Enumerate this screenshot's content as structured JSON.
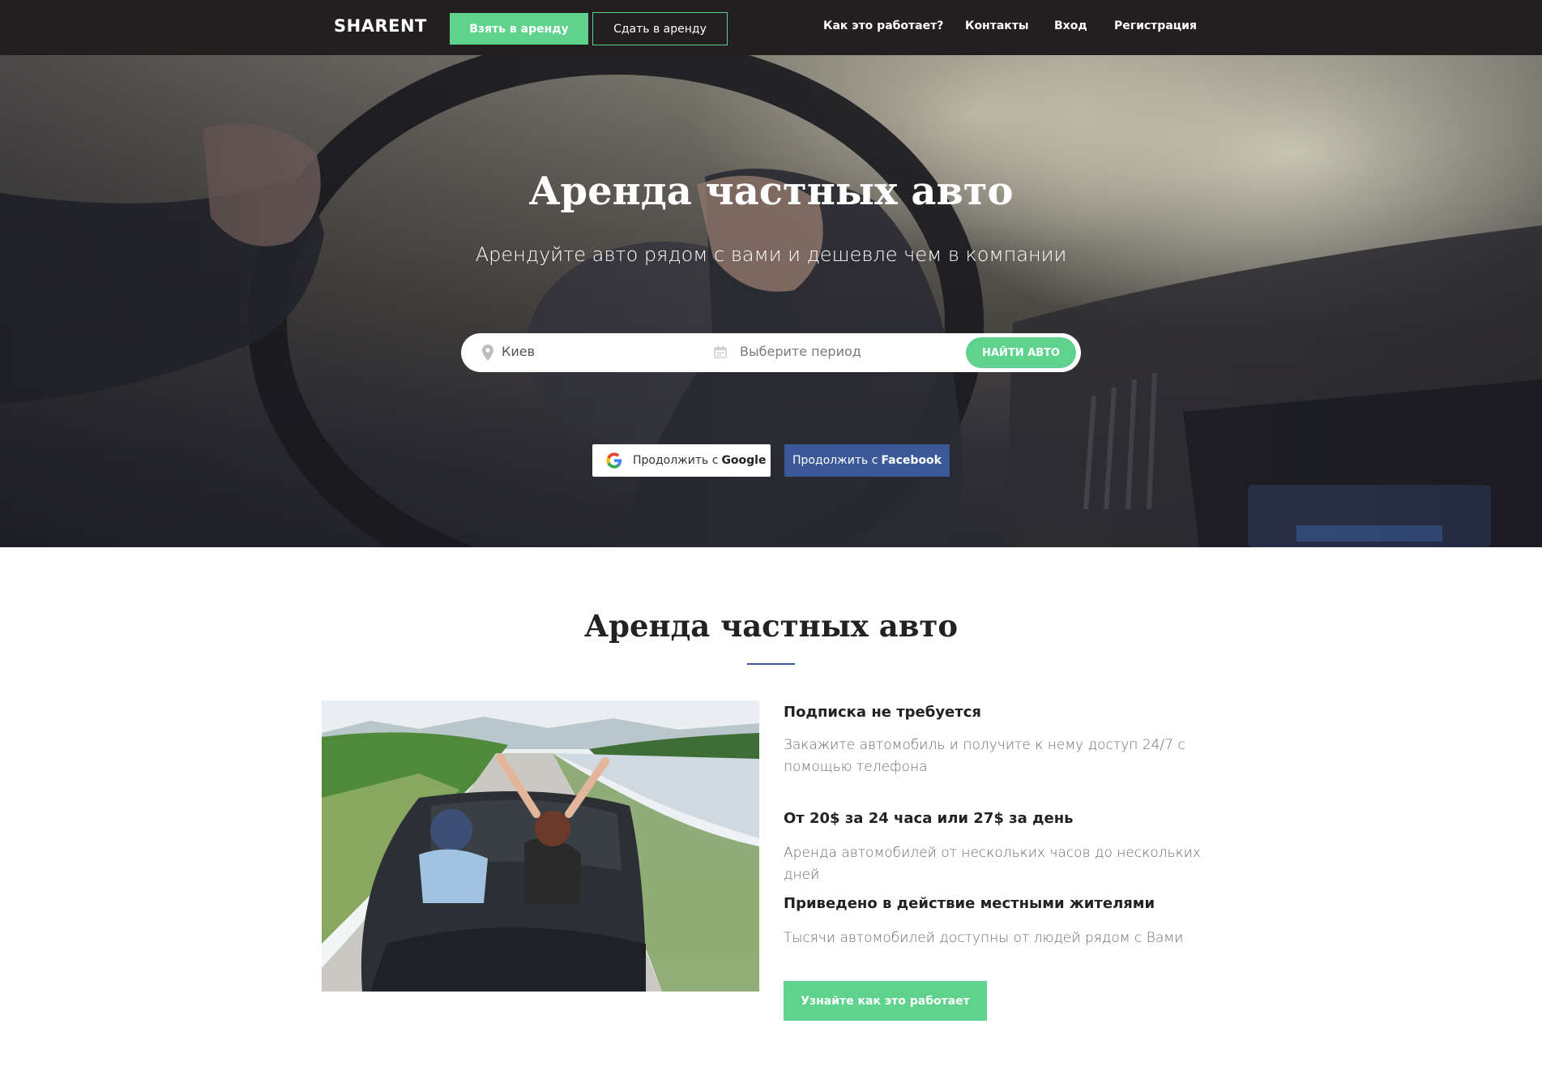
{
  "nav": {
    "logo": "SHARENT",
    "rent_button": "Взять в аренду",
    "lend_button": "Сдать в аренду",
    "links": [
      "Как это работает?",
      "Контакты",
      "Вход",
      "Регистрация"
    ]
  },
  "hero": {
    "title": "Аренда частных авто",
    "subtitle": "Арендуйте авто рядом с вами и дешевле чем в компании",
    "search": {
      "city_value": "Киев",
      "period_placeholder": "Выберите период",
      "submit_label": "НАЙТИ АВТО"
    },
    "google_button": {
      "prefix": "Продолжить с",
      "brand": "Google"
    },
    "facebook_button": {
      "prefix": "Продолжить с",
      "brand": "Facebook"
    }
  },
  "section": {
    "title": "Аренда частных авто",
    "features": [
      {
        "heading": "Подписка не требуется",
        "text": "Закажите автомобиль и получите к нему доступ 24/7 с помощью телефона"
      },
      {
        "heading": "От 20$ за 24 часа или 27$ за день",
        "text": "Аренда автомобилей от нескольких часов до нескольких дней"
      },
      {
        "heading": "Приведено в действие местными жителями",
        "text": "Тысячи автомобилей доступны от людей рядом с Вами"
      }
    ],
    "cta_button": "Узнайте как это работает"
  },
  "colors": {
    "nav_bg": "#231f20",
    "accent_green": "#5fd38d",
    "facebook_blue": "#3b5998",
    "heading": "#222222",
    "body_text": "#6b6b6b"
  },
  "icons": [
    "location-pin-icon",
    "calendar-icon",
    "google-logo-icon"
  ]
}
